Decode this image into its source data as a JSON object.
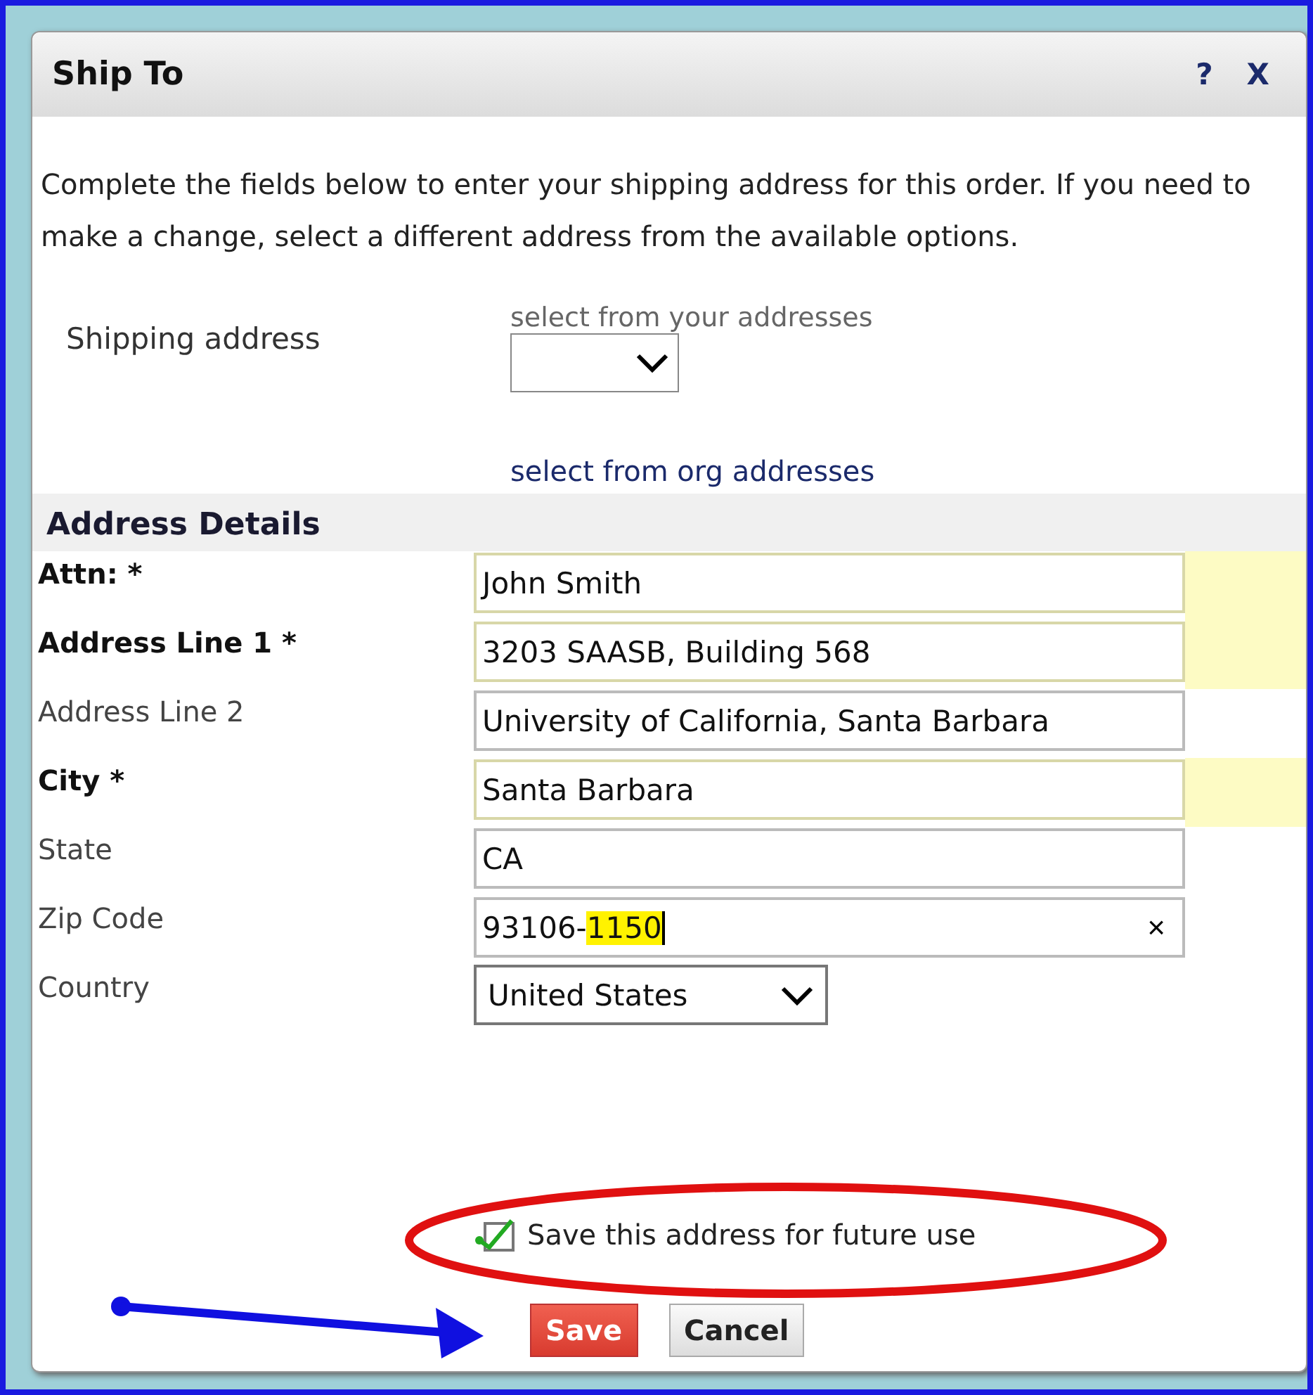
{
  "dialog": {
    "title": "Ship To",
    "help": "?",
    "close": "X"
  },
  "intro": "Complete the fields below to enter your shipping address for this order. If you need to make a change, select a different address from the available options.",
  "shipping": {
    "label": "Shipping address",
    "hint": "select from your addresses",
    "link": "select from org addresses"
  },
  "section": "Address Details",
  "fields": [
    {
      "kind": "text",
      "label": "Attn: *",
      "required": true,
      "value": "John Smith"
    },
    {
      "kind": "text",
      "label": "Address Line 1 *",
      "required": true,
      "value": "3203 SAASB, Building 568"
    },
    {
      "kind": "text",
      "label": "Address Line 2",
      "required": false,
      "value": "University of California, Santa Barbara"
    },
    {
      "kind": "text",
      "label": "City *",
      "required": true,
      "value": "Santa Barbara"
    },
    {
      "kind": "text",
      "label": "State",
      "required": false,
      "value": "CA"
    },
    {
      "kind": "text",
      "label": "Zip Code",
      "required": false,
      "value": "93106-",
      "highlighted": "1150",
      "clear": "×"
    },
    {
      "kind": "select",
      "label": "Country",
      "required": false,
      "value": "United States"
    }
  ],
  "save_option": {
    "label": "Save this address for future use",
    "checked": true
  },
  "buttons": [
    {
      "label": "Save",
      "kind": "primary"
    },
    {
      "label": "Cancel",
      "kind": "secondary"
    }
  ]
}
